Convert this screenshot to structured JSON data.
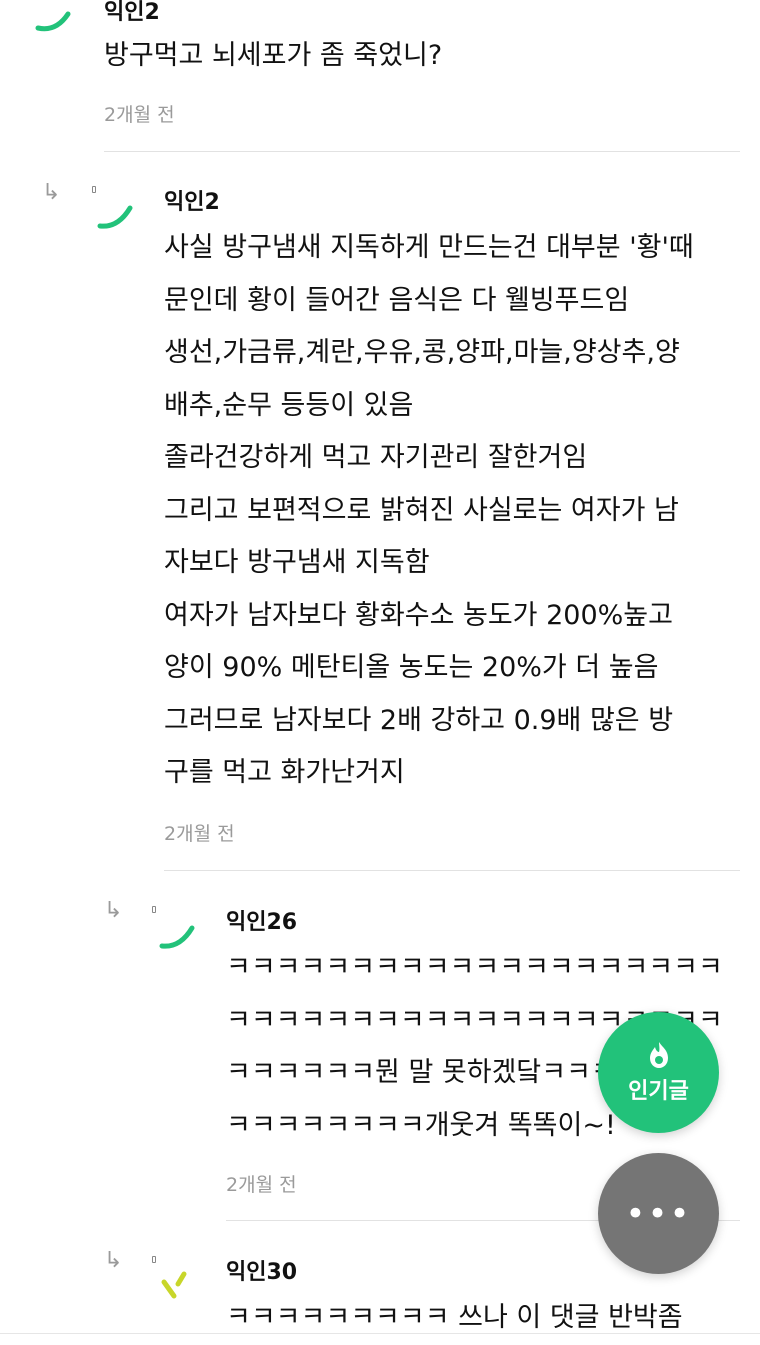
{
  "comments": [
    {
      "author": "익인2",
      "lines": [
        "방구먹고 뇌세포가 좀 죽었니?"
      ],
      "time": "2개월 전",
      "avatar_color": "#22c27a"
    },
    {
      "author": "익인2",
      "lines": [
        "사실 방구냄새 지독하게 만드는건 대부분 '황'때",
        "문인데 황이 들어간 음식은 다 웰빙푸드임",
        "생선,가금류,계란,우유,콩,양파,마늘,양상추,양",
        "배추,순무 등등이 있음",
        "졸라건강하게 먹고 자기관리 잘한거임",
        "그리고 보편적으로 밝혀진 사실로는 여자가 남",
        "자보다 방구냄새 지독함",
        "여자가 남자보다 황화수소 농도가 200%높고",
        "양이 90% 메탄티올 농도는 20%가 더 높음",
        "그러므로 남자보다 2배 강하고 0.9배 많은 방",
        "구를 먹고 화가난거지"
      ],
      "time": "2개월 전",
      "avatar_color": "#22c27a"
    },
    {
      "author": "익인26",
      "lines": [
        "ㅋㅋㅋㅋㅋㅋㅋㅋㅋㅋㅋㅋㅋㅋㅋㅋㅋㅋㅋㅋ",
        "ㅋㅋㅋㅋㅋㅋㅋㅋㅋㅋㅋㅋㅋㅋㅋㅋㅋㅋㅋㅋ",
        "ㅋㅋㅋㅋㅋㅋ뭔 말 못하겠닼ㅋㅋㅋㅋ",
        "ㅋㅋㅋㅋㅋㅋㅋㅋ개웃겨 똑똑이~!"
      ],
      "time": "2개월 전",
      "avatar_color": "#22c27a"
    },
    {
      "author": "익인30",
      "lines": [
        "ㅋㅋㅋㅋㅋㅋㅋㅋㅋ 쓰나 이 댓글 반박좀"
      ],
      "avatar_color": "#c8d62a"
    }
  ],
  "reply_icon": "reply-arrow-icon",
  "fab": {
    "hot_label": "인기글",
    "hot_icon": "flame-icon",
    "more_icon": "more-dots-icon",
    "more_glyph": "•••",
    "hot_color": "#22c27a",
    "more_color": "#757575"
  }
}
